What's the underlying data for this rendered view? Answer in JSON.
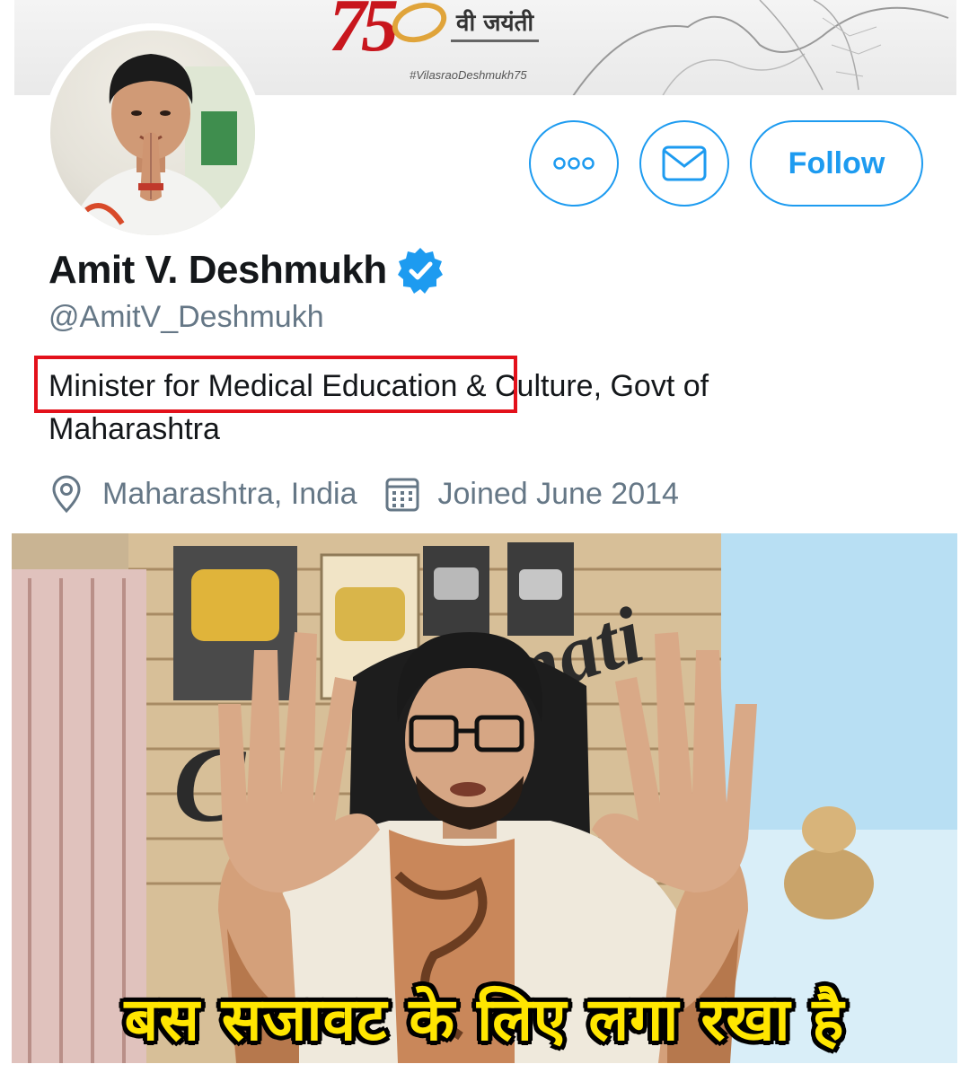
{
  "banner": {
    "jayanti_text": "वी जयंती",
    "hashtag": "#VilasraoDeshmukh75",
    "number_text": "75"
  },
  "profile": {
    "display_name": "Amit V. Deshmukh",
    "handle": "@AmitV_Deshmukh",
    "bio_highlighted": "Minister for Medical Education",
    "bio_rest": " & Culture, Govt of Maharashtra",
    "location": "Maharashtra, India",
    "joined": "Joined June 2014",
    "verified": true
  },
  "actions": {
    "more_icon": "more-icon",
    "message_icon": "envelope-icon",
    "follow_label": "Follow"
  },
  "colors": {
    "accent": "#1d9bf0",
    "highlight_box": "#e3111b",
    "meta_text": "#657786",
    "caption": "#ffe600"
  },
  "meme": {
    "caption": "बस सजावट के लिए लगा रखा है"
  }
}
